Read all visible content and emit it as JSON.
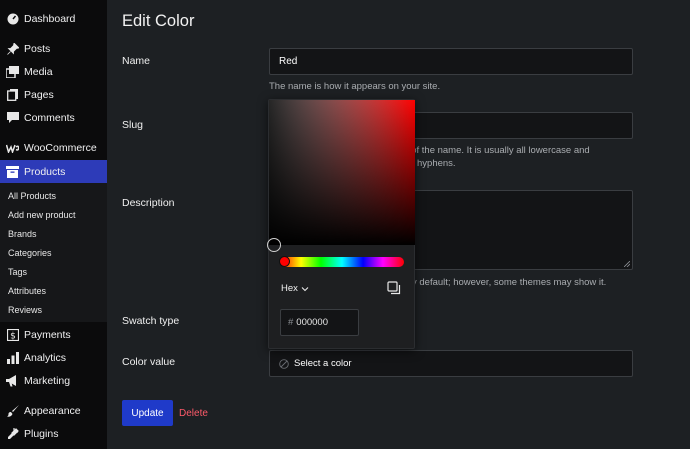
{
  "sidebar": {
    "top_items": [
      {
        "label": "Dashboard",
        "icon": "dashboard-icon"
      },
      {
        "label": "Posts",
        "icon": "pin-icon"
      },
      {
        "label": "Media",
        "icon": "media-icon"
      },
      {
        "label": "Pages",
        "icon": "pages-icon"
      },
      {
        "label": "Comments",
        "icon": "comment-icon"
      },
      {
        "label": "WooCommerce",
        "icon": "woocommerce-icon"
      },
      {
        "label": "Products",
        "icon": "products-icon"
      }
    ],
    "submenu": [
      "All Products",
      "Add new product",
      "Brands",
      "Categories",
      "Tags",
      "Attributes",
      "Reviews"
    ],
    "bottom_items": [
      {
        "label": "Payments",
        "icon": "payments-icon"
      },
      {
        "label": "Analytics",
        "icon": "analytics-icon"
      },
      {
        "label": "Marketing",
        "icon": "marketing-icon"
      },
      {
        "label": "Appearance",
        "icon": "appearance-icon"
      },
      {
        "label": "Plugins",
        "icon": "plugins-icon"
      }
    ],
    "active_color": "#2d3bb8"
  },
  "page": {
    "title": "Edit Color",
    "name_label": "Name",
    "name_value": "Red",
    "name_help": "The name is how it appears on your site.",
    "slug_label": "Slug",
    "slug_help_line1": "on of the name. It is usually all lowercase and",
    "slug_help_line2": "hyphens.",
    "description_label": "Description",
    "description_help": "y default; however, some themes may show it.",
    "swatch_label": "Swatch type",
    "color_label": "Color value",
    "color_placeholder": "Select a color",
    "update_label": "Update",
    "delete_label": "Delete"
  },
  "picker": {
    "format": "Hex",
    "hash": "#",
    "hex_value": "000000",
    "hue_color": "#ff0000"
  }
}
